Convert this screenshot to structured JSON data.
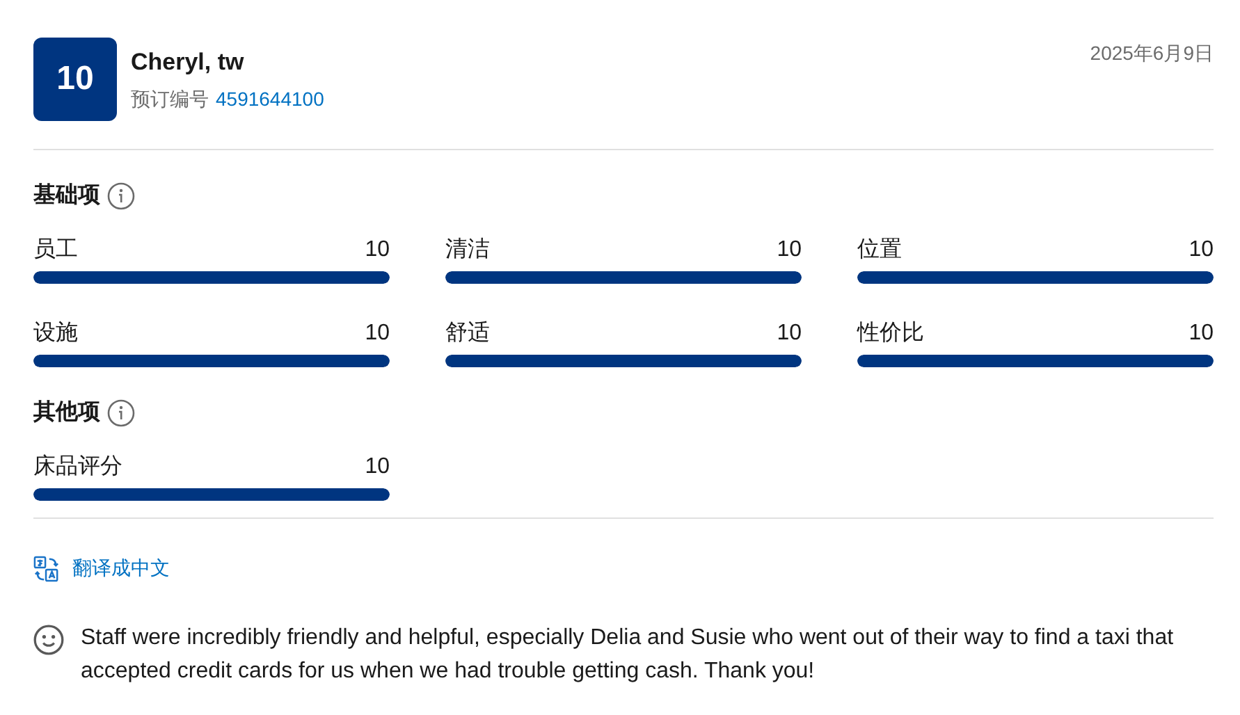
{
  "header": {
    "score": "10",
    "name": "Cheryl, tw",
    "booking_label": "预订编号",
    "booking_number": "4591644100",
    "date": "2025年6月9日"
  },
  "sections": [
    {
      "title": "基础项",
      "items": [
        {
          "label": "员工",
          "value": "10",
          "level": 1
        },
        {
          "label": "清洁",
          "value": "10",
          "level": 1
        },
        {
          "label": "位置",
          "value": "10",
          "level": 1
        },
        {
          "label": "设施",
          "value": "10",
          "level": 1
        },
        {
          "label": "舒适",
          "value": "10",
          "level": 1
        },
        {
          "label": "性价比",
          "value": "10",
          "level": 1
        }
      ]
    },
    {
      "title": "其他项",
      "items": [
        {
          "label": "床品评分",
          "value": "10",
          "level": 1
        }
      ]
    }
  ],
  "translate_link": "翻译成中文",
  "review": {
    "text": "Staff were incredibly friendly and helpful, especially Delia and Susie who went out of their way to find a taxi that accepted credit cards for us when we had trouble getting cash. Thank you!"
  }
}
